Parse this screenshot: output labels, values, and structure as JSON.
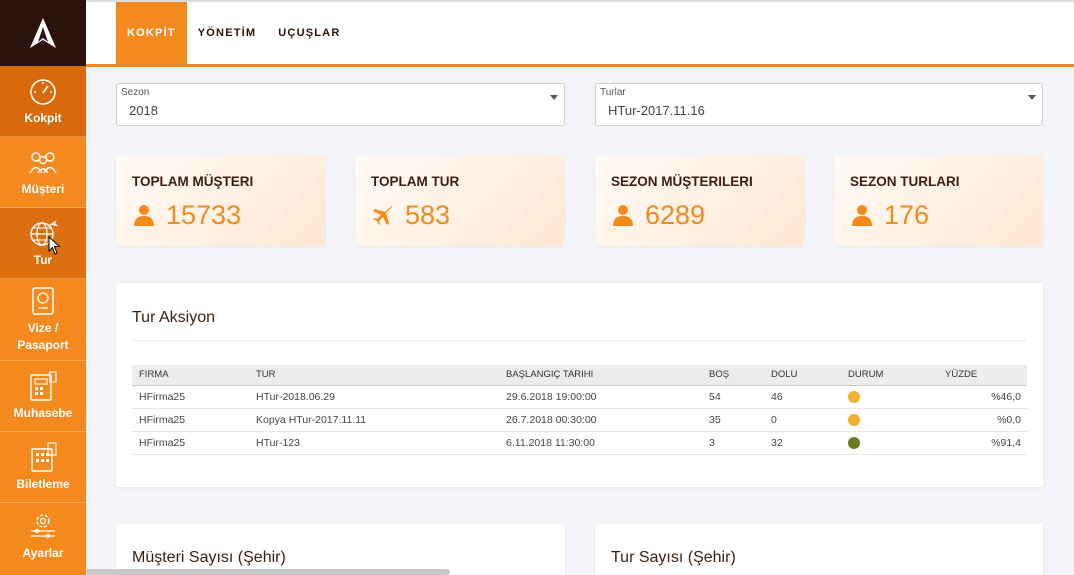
{
  "sidebar": {
    "items": [
      {
        "label": "Kokpit",
        "icon": "gauge-icon"
      },
      {
        "label": "Müşteri",
        "icon": "people-icon"
      },
      {
        "label": "Tur",
        "icon": "globe-plane-icon"
      },
      {
        "label": "Vize / Pasaport",
        "icon": "passport-icon"
      },
      {
        "label": "Muhasebe",
        "icon": "calculator-icon"
      },
      {
        "label": "Biletleme",
        "icon": "ticket-icon"
      },
      {
        "label": "Ayarlar",
        "icon": "settings-icon"
      }
    ]
  },
  "topbar": {
    "tabs": [
      {
        "label": "KOKPİT"
      },
      {
        "label": "YÖNETİM"
      },
      {
        "label": "UÇUŞLAR"
      }
    ]
  },
  "filters": {
    "season": {
      "label": "Sezon",
      "value": "2018"
    },
    "tours": {
      "label": "Turlar",
      "value": "HTur-2017.11.16"
    }
  },
  "stats": [
    {
      "title": "TOPLAM MÜŞTERI",
      "value": "15733",
      "icon": "user-icon"
    },
    {
      "title": "TOPLAM TUR",
      "value": "583",
      "icon": "plane-icon"
    },
    {
      "title": "SEZON MÜŞTERILERI",
      "value": "6289",
      "icon": "user-icon"
    },
    {
      "title": "SEZON TURLARI",
      "value": "176",
      "icon": "user-icon"
    }
  ],
  "tour_action": {
    "title": "Tur Aksiyon",
    "columns": [
      "FIRMA",
      "TUR",
      "BAŞLANGIÇ TARIHI",
      "BOŞ",
      "DOLU",
      "DURUM",
      "YÜZDE"
    ],
    "rows": [
      {
        "firma": "HFirma25",
        "tur": "HTur-2018.06.29",
        "start": "29.6.2018 19:00:00",
        "bos": "54",
        "dolu": "46",
        "status_color": "#f0b030",
        "yuzde": "%46,0"
      },
      {
        "firma": "HFirma25",
        "tur": "Kopya HTur-2017.11.11",
        "start": "26.7.2018 00:30:00",
        "bos": "35",
        "dolu": "0",
        "status_color": "#f0b030",
        "yuzde": "%0,0"
      },
      {
        "firma": "HFirma25",
        "tur": "HTur-123",
        "start": "6.11.2018 11:30:00",
        "bos": "3",
        "dolu": "32",
        "status_color": "#6b7a1e",
        "yuzde": "%91,4"
      }
    ]
  },
  "bottom_panels": {
    "left_title": "Müşteri Sayısı (Şehir)",
    "right_title": "Tur Sayısı (Şehir)"
  },
  "colors": {
    "accent": "#f48a1e",
    "sidebar_dark": "#2d1209"
  }
}
